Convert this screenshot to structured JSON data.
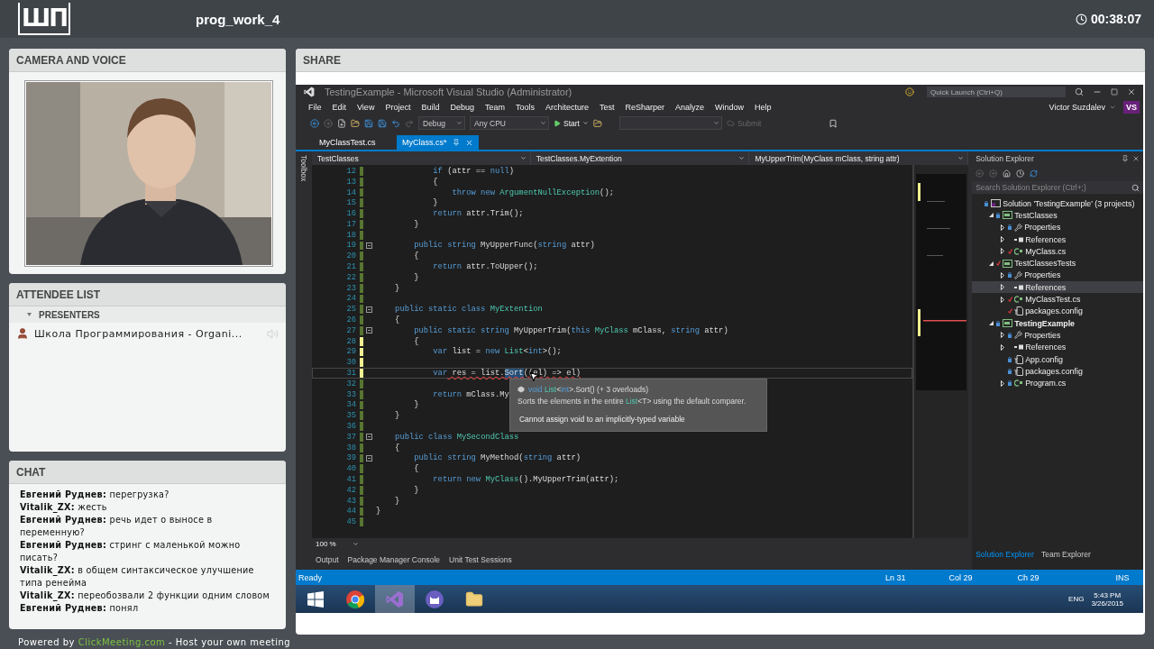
{
  "header": {
    "logo": "ШП",
    "title": "prog_work_4",
    "timer": "00:38:07"
  },
  "camera": {
    "title": "CAMERA AND VOICE"
  },
  "attendees": {
    "title": "ATTENDEE LIST",
    "groups": [
      {
        "label": "PRESENTERS",
        "expanded": true,
        "people": [
          {
            "name": "Школа Программирования - Organi...",
            "speaking": false
          }
        ]
      }
    ]
  },
  "chat": {
    "title": "CHAT",
    "messages": [
      {
        "author": "Евгений Руднев:",
        "text": "перегрузка?"
      },
      {
        "author": "Vitalik_ZX:",
        "text": "жесть"
      },
      {
        "author": "Евгений Руднев:",
        "text": "речь идет о выносе в переменную?"
      },
      {
        "author": "Евгений Руднев:",
        "text": "стринг с маленькой можно писать?"
      },
      {
        "author": "Vitalik_ZX:",
        "text": "в общем синтаксическое улучшение типа ренейма"
      },
      {
        "author": "Vitalik_ZX:",
        "text": "переобозвали 2 функции одним словом"
      },
      {
        "author": "Евгений Руднев:",
        "text": "понял"
      }
    ]
  },
  "footer": {
    "prefix": "Powered by",
    "link": "ClickMeeting.com",
    "suffix": "- Host your own meeting"
  },
  "share": {
    "title": "SHARE",
    "vs": {
      "window_title": "TestingExample - Microsoft Visual Studio (Administrator)",
      "quick_launch": {
        "placeholder": "Quick Launch (Ctrl+Q)"
      },
      "menu": [
        "File",
        "Edit",
        "View",
        "Project",
        "Build",
        "Debug",
        "Team",
        "Tools",
        "Architecture",
        "Test",
        "ReSharper",
        "Analyze",
        "Window",
        "Help"
      ],
      "user": {
        "name": "Victor Suzdalev",
        "initials": "VS"
      },
      "toolbar": {
        "configuration": "Debug",
        "platform": "Any CPU",
        "start": "Start",
        "submit": {
          "label": "Submit",
          "disabled": true
        }
      },
      "tabs": [
        {
          "label": "MyClassTest.cs",
          "selected": false
        },
        {
          "label": "MyClass.cs*",
          "selected": true
        }
      ],
      "toolbox": "Toolbox",
      "navbar": [
        "TestClasses",
        "TestClasses.MyExtention",
        "MyUpperTrim(MyClass mClass, string attr)"
      ],
      "code": [
        {
          "number": "12",
          "edited": false,
          "tokens": [
            {
              "text": "            if",
              "kind": "keyword"
            },
            {
              "text": " (attr == ",
              "kind": "plain"
            },
            {
              "text": "null",
              "kind": "keyword"
            },
            {
              "text": ")",
              "kind": "plain"
            }
          ]
        },
        {
          "number": "13",
          "edited": false,
          "tokens": [
            {
              "text": "            {",
              "kind": "plain"
            }
          ]
        },
        {
          "number": "14",
          "edited": false,
          "tokens": [
            {
              "text": "                throw new",
              "kind": "keyword"
            },
            {
              "text": " ArgumentNullException",
              "kind": "type"
            },
            {
              "text": "();",
              "kind": "plain"
            }
          ]
        },
        {
          "number": "15",
          "edited": false,
          "tokens": [
            {
              "text": "            }",
              "kind": "plain"
            }
          ]
        },
        {
          "number": "16",
          "edited": false,
          "tokens": [
            {
              "text": "            return",
              "kind": "keyword"
            },
            {
              "text": " attr.Trim();",
              "kind": "plain"
            }
          ]
        },
        {
          "number": "17",
          "edited": false,
          "tokens": [
            {
              "text": "        }",
              "kind": "plain"
            }
          ]
        },
        {
          "number": "18",
          "edited": false
        },
        {
          "number": "19",
          "edited": false,
          "fold": true,
          "tokens": [
            {
              "text": "        public string",
              "kind": "keyword"
            },
            {
              "text": " MyUpperFunc(",
              "kind": "plain"
            },
            {
              "text": "string",
              "kind": "keyword"
            },
            {
              "text": " attr)",
              "kind": "plain"
            }
          ]
        },
        {
          "number": "20",
          "edited": false,
          "tokens": [
            {
              "text": "        {",
              "kind": "plain"
            }
          ]
        },
        {
          "number": "21",
          "edited": false,
          "tokens": [
            {
              "text": "            return",
              "kind": "keyword"
            },
            {
              "text": " attr.ToUpper();",
              "kind": "plain"
            }
          ]
        },
        {
          "number": "22",
          "edited": false,
          "tokens": [
            {
              "text": "        }",
              "kind": "plain"
            }
          ]
        },
        {
          "number": "23",
          "edited": false,
          "tokens": [
            {
              "text": "    }",
              "kind": "plain"
            }
          ]
        },
        {
          "number": "24",
          "edited": false
        },
        {
          "number": "25",
          "edited": false,
          "fold": true,
          "tokens": [
            {
              "text": "    public static class",
              "kind": "keyword"
            },
            {
              "text": " MyExtention",
              "kind": "type"
            }
          ]
        },
        {
          "number": "26",
          "edited": false,
          "tokens": [
            {
              "text": "    {",
              "kind": "plain"
            }
          ]
        },
        {
          "number": "27",
          "edited": false,
          "fold": true,
          "tokens": [
            {
              "text": "        public static string",
              "kind": "keyword"
            },
            {
              "text": " MyUpperTrim(",
              "kind": "plain"
            },
            {
              "text": "this",
              "kind": "keyword"
            },
            {
              "text": " MyClass",
              "kind": "type"
            },
            {
              "text": " mClass, ",
              "kind": "plain"
            },
            {
              "text": "string",
              "kind": "keyword"
            },
            {
              "text": " attr)",
              "kind": "plain"
            }
          ]
        },
        {
          "number": "28",
          "edited": true,
          "tokens": [
            {
              "text": "        {",
              "kind": "plain"
            }
          ]
        },
        {
          "number": "29",
          "edited": true,
          "tokens": [
            {
              "text": "            var",
              "kind": "keyword"
            },
            {
              "text": " list = ",
              "kind": "plain"
            },
            {
              "text": "new",
              "kind": "keyword"
            },
            {
              "text": " List",
              "kind": "type"
            },
            {
              "text": "<",
              "kind": "plain"
            },
            {
              "text": "int",
              "kind": "keyword"
            },
            {
              "text": ">();",
              "kind": "plain"
            }
          ]
        },
        {
          "number": "30",
          "edited": true
        },
        {
          "number": "31",
          "edited": true,
          "current": true,
          "tokens": [
            {
              "text": "            var",
              "kind": "keyword"
            },
            {
              "text": " res = list.",
              "kind": "error"
            },
            {
              "text": "Sort",
              "kind": "selected"
            },
            {
              "text": "((el) => el)",
              "kind": "error"
            }
          ]
        },
        {
          "number": "32",
          "edited": false
        },
        {
          "number": "33",
          "edited": false,
          "tokens": [
            {
              "text": "            return",
              "kind": "keyword"
            },
            {
              "text": " mClass.My",
              "kind": "plain"
            }
          ]
        },
        {
          "number": "34",
          "edited": false,
          "tokens": [
            {
              "text": "        }",
              "kind": "plain"
            }
          ]
        },
        {
          "number": "35",
          "edited": false,
          "tokens": [
            {
              "text": "    }",
              "kind": "plain"
            }
          ]
        },
        {
          "number": "36",
          "edited": false
        },
        {
          "number": "37",
          "edited": false,
          "fold": true,
          "tokens": [
            {
              "text": "    public class",
              "kind": "keyword"
            },
            {
              "text": " MySecondClass",
              "kind": "type"
            }
          ]
        },
        {
          "number": "38",
          "edited": false,
          "tokens": [
            {
              "text": "    {",
              "kind": "plain"
            }
          ]
        },
        {
          "number": "39",
          "edited": false,
          "fold": true,
          "tokens": [
            {
              "text": "        public string",
              "kind": "keyword"
            },
            {
              "text": " MyMethod(",
              "kind": "plain"
            },
            {
              "text": "string",
              "kind": "keyword"
            },
            {
              "text": " attr)",
              "kind": "plain"
            }
          ]
        },
        {
          "number": "40",
          "edited": false,
          "tokens": [
            {
              "text": "        {",
              "kind": "plain"
            }
          ]
        },
        {
          "number": "41",
          "edited": false,
          "tokens": [
            {
              "text": "            return new",
              "kind": "keyword"
            },
            {
              "text": " MyClass",
              "kind": "type"
            },
            {
              "text": "().MyUpperTrim(attr);",
              "kind": "plain"
            }
          ]
        },
        {
          "number": "42",
          "edited": false,
          "tokens": [
            {
              "text": "        }",
              "kind": "plain"
            }
          ]
        },
        {
          "number": "43",
          "edited": false,
          "tokens": [
            {
              "text": "    }",
              "kind": "plain"
            }
          ]
        },
        {
          "number": "44",
          "edited": false,
          "tokens": [
            {
              "text": "}",
              "kind": "plain"
            }
          ]
        },
        {
          "number": "45",
          "edited": false
        }
      ],
      "tooltip": {
        "signature": [
          {
            "text": "void",
            "kind": "keyword"
          },
          {
            "text": " List",
            "kind": "type"
          },
          {
            "text": "<",
            "kind": "plain"
          },
          {
            "text": "int",
            "kind": "keyword"
          },
          {
            "text": ">.Sort() (+ 3 overloads)",
            "kind": "plain"
          }
        ],
        "summary": [
          {
            "text": "Sorts the elements in the entire ",
            "kind": "plain"
          },
          {
            "text": "List",
            "kind": "type"
          },
          {
            "text": "<T> using the default comparer.",
            "kind": "plain"
          }
        ],
        "error": "Cannot assign void to an implicitly-typed variable"
      },
      "zoom": "100 %",
      "output_tabs": [
        "Output",
        "Package Manager Console",
        "Unit Test Sessions"
      ],
      "status": {
        "message": "Ready",
        "line": "Ln 31",
        "col": "Col 29",
        "ch": "Ch 29",
        "mode": "INS"
      },
      "solution_explorer": {
        "title": "Solution Explorer",
        "search": {
          "placeholder": "Search Solution Explorer (Ctrl+;)"
        },
        "tree": [
          {
            "label": "Solution 'TestingExample' (3 projects)",
            "kind": "solution",
            "locked": true,
            "checked_out": false,
            "selected": false,
            "children": [
              {
                "label": "TestClasses",
                "kind": "project",
                "locked": true,
                "checked_out": false,
                "expanded": true,
                "startup": false,
                "selected": false,
                "children": [
                  {
                    "label": "Properties",
                    "kind": "properties",
                    "locked": true,
                    "checked_out": false,
                    "expanded": false,
                    "selected": false
                  },
                  {
                    "label": "References",
                    "kind": "references",
                    "locked": false,
                    "checked_out": false,
                    "expanded": false,
                    "selected": false
                  },
                  {
                    "label": "MyClass.cs",
                    "kind": "csfile",
                    "locked": false,
                    "checked_out": true,
                    "expanded": false,
                    "selected": false
                  }
                ]
              },
              {
                "label": "TestClassesTests",
                "kind": "project",
                "locked": false,
                "checked_out": true,
                "expanded": true,
                "startup": false,
                "selected": false,
                "children": [
                  {
                    "label": "Properties",
                    "kind": "properties",
                    "locked": true,
                    "checked_out": false,
                    "expanded": false,
                    "selected": false
                  },
                  {
                    "label": "References",
                    "kind": "references",
                    "locked": false,
                    "checked_out": false,
                    "expanded": false,
                    "selected": true
                  },
                  {
                    "label": "MyClassTest.cs",
                    "kind": "csfile",
                    "locked": false,
                    "checked_out": true,
                    "expanded": false,
                    "selected": false
                  },
                  {
                    "label": "packages.config",
                    "kind": "config",
                    "locked": false,
                    "checked_out": true,
                    "selected": false
                  }
                ]
              },
              {
                "label": "TestingExample",
                "kind": "project",
                "locked": true,
                "checked_out": false,
                "expanded": true,
                "startup": true,
                "selected": false,
                "children": [
                  {
                    "label": "Properties",
                    "kind": "properties",
                    "locked": true,
                    "checked_out": false,
                    "expanded": false,
                    "selected": false
                  },
                  {
                    "label": "References",
                    "kind": "references",
                    "locked": false,
                    "checked_out": false,
                    "expanded": false,
                    "selected": false
                  },
                  {
                    "label": "App.config",
                    "kind": "config",
                    "locked": true,
                    "checked_out": false,
                    "selected": false
                  },
                  {
                    "label": "packages.config",
                    "kind": "config",
                    "locked": true,
                    "checked_out": false,
                    "selected": false
                  },
                  {
                    "label": "Program.cs",
                    "kind": "csfile",
                    "locked": true,
                    "checked_out": false,
                    "expanded": false,
                    "selected": false
                  }
                ]
              }
            ]
          }
        ],
        "tabs": [
          {
            "label": "Solution Explorer",
            "selected": true
          },
          {
            "label": "Team Explorer",
            "selected": false
          }
        ]
      },
      "taskbar": {
        "apps": [
          {
            "kind": "start",
            "selected": false
          },
          {
            "kind": "chrome",
            "selected": false
          },
          {
            "kind": "vs",
            "selected": true
          },
          {
            "kind": "cat",
            "selected": false
          },
          {
            "kind": "folder",
            "selected": false
          }
        ],
        "lang": "ENG",
        "time": "5:43 PM",
        "date": "3/26/2015"
      }
    }
  }
}
